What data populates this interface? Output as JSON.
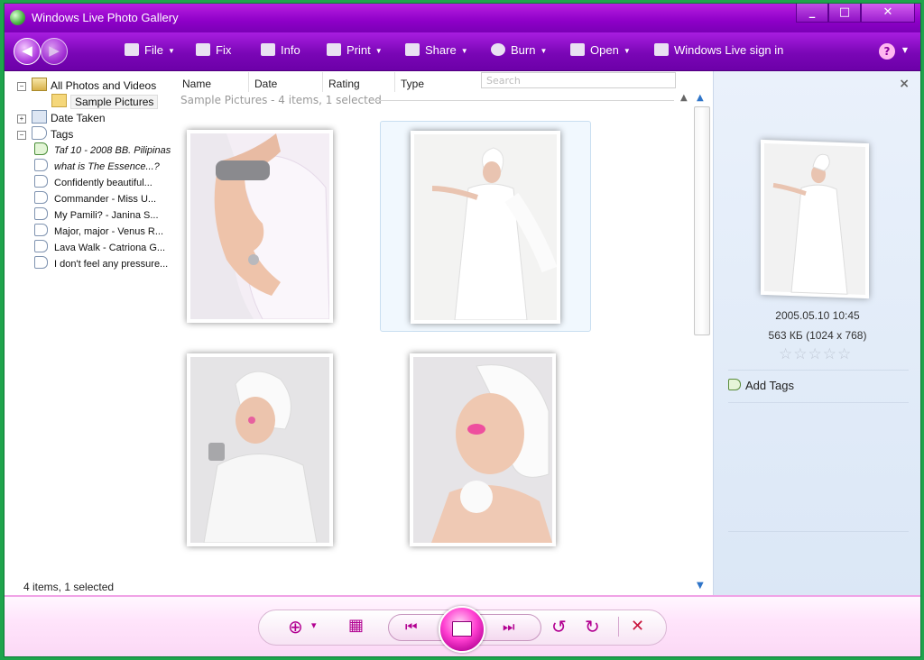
{
  "window": {
    "title": "Windows Live Photo Gallery"
  },
  "titlebar_buttons": {
    "minimize": "_",
    "maximize": "□",
    "close": "✕"
  },
  "toolbar": {
    "items": [
      {
        "label": "File",
        "icon": "file-icon",
        "dropdown": true
      },
      {
        "label": "Fix",
        "icon": "fix-icon",
        "dropdown": false
      },
      {
        "label": "Info",
        "icon": "info-tag-icon",
        "dropdown": false
      },
      {
        "label": "Print",
        "icon": "printer-icon",
        "dropdown": true
      },
      {
        "label": "Share",
        "icon": "share-icon",
        "dropdown": true
      },
      {
        "label": "Burn",
        "icon": "disc-icon",
        "dropdown": true
      },
      {
        "label": "Open",
        "icon": "open-icon",
        "dropdown": true
      },
      {
        "label": "Windows Live sign in",
        "icon": "windows-live-icon",
        "dropdown": false
      }
    ],
    "help": "?"
  },
  "tree": {
    "all_photos": "All Photos and Videos",
    "sample_pictures": "Sample Pictures",
    "date_taken": "Date Taken",
    "tags": "Tags",
    "tag_items": [
      "Taf 10 - 2008 BB. Pilipinas",
      "what is The Essence...?",
      "Confidently beautiful...",
      "Commander - Miss U...",
      "My Pamili? - Janina S...",
      "Major, major - Venus R...",
      "Lava Walk - Catriona G...",
      "I don't feel any pressure..."
    ]
  },
  "columns": [
    "Name",
    "Date",
    "Rating",
    "Type"
  ],
  "search": {
    "placeholder": "Search"
  },
  "group": {
    "label": "Sample Pictures -  4 items, 1 selected"
  },
  "status": {
    "text": "4 items, 1 selected"
  },
  "details": {
    "date": "2005.05.10    10:45",
    "size": "563 КБ (1024 x 768)",
    "stars": "☆☆☆☆☆",
    "add_tags": "Add Tags",
    "close": "×"
  },
  "bottom": {
    "zoom": "⊕",
    "zoom_dd": "▾",
    "grid": "▦",
    "prev": "⏮",
    "next": "⏭",
    "rotate_left": "↺",
    "rotate_right": "↻",
    "delete": "✕"
  },
  "colors": {
    "accent": "#8e00c8",
    "bottom_accent": "#b20091",
    "frame": "#1fa44c"
  }
}
